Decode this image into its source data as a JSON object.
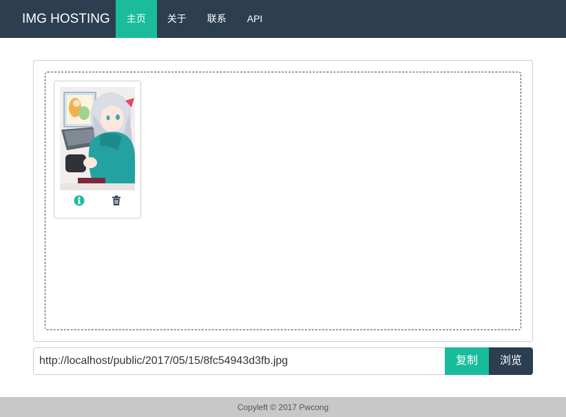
{
  "navbar": {
    "brand": "IMG HOSTING",
    "items": [
      {
        "label": "主页",
        "active": true
      },
      {
        "label": "关于",
        "active": false
      },
      {
        "label": "联系",
        "active": false
      },
      {
        "label": "API",
        "active": false
      }
    ]
  },
  "gallery": {
    "images": [
      {
        "actions": [
          "info-icon",
          "trash-icon"
        ]
      }
    ]
  },
  "url_bar": {
    "value": "http://localhost/public/2017/05/15/8fc54943d3fb.jpg",
    "copy_label": "复制",
    "view_label": "浏览"
  },
  "footer": {
    "text": "Copyleft © 2017 Pwcong"
  },
  "colors": {
    "navbar_bg": "#2c3e50",
    "accent": "#1abc9c",
    "footer_bg": "#c8c8c8"
  }
}
